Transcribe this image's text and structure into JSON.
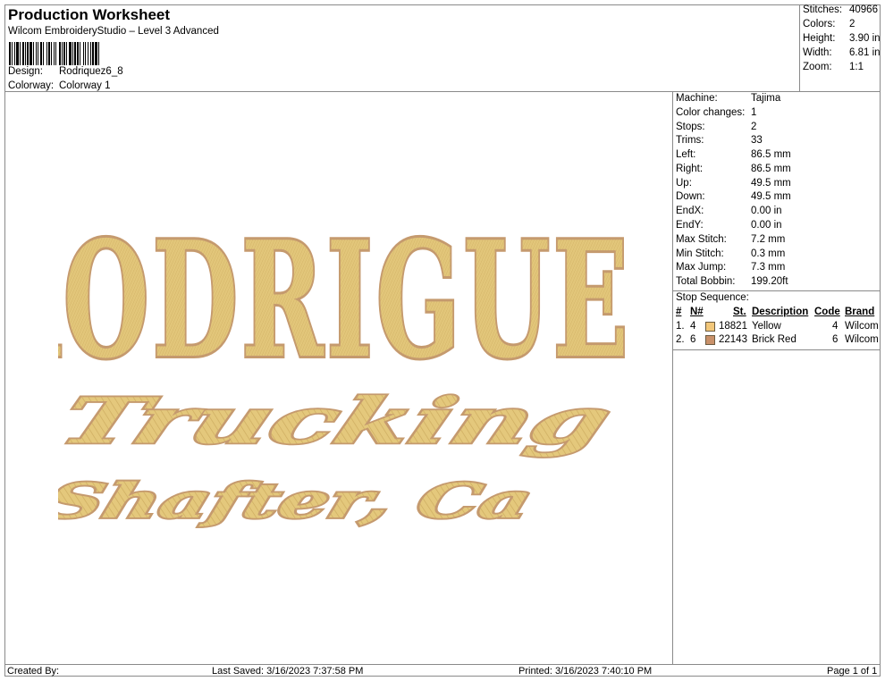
{
  "header": {
    "title": "Production Worksheet",
    "app": "Wilcom EmbroideryStudio – Level 3 Advanced",
    "design_label": "Design:",
    "design_value": "Rodriquez6_8",
    "colorway_label": "Colorway:",
    "colorway_value": "Colorway 1"
  },
  "stats": [
    {
      "k": "Stitches:",
      "v": "40966"
    },
    {
      "k": "Colors:",
      "v": "2"
    },
    {
      "k": "Height:",
      "v": "3.90 in"
    },
    {
      "k": "Width:",
      "v": "6.81 in"
    },
    {
      "k": "Zoom:",
      "v": "1:1"
    }
  ],
  "design": {
    "line1": "RODRIGUEZ",
    "line2": "Trucking",
    "line3": "Shafter, Ca",
    "fill_color": "#e2c67a",
    "outline_color": "#c59a6e"
  },
  "machine_info": [
    {
      "k": "Machine:",
      "v": "Tajima"
    },
    {
      "k": "Color changes:",
      "v": "1"
    },
    {
      "k": "Stops:",
      "v": "2"
    },
    {
      "k": "Trims:",
      "v": "33"
    },
    {
      "k": "Left:",
      "v": "86.5 mm"
    },
    {
      "k": "Right:",
      "v": "86.5 mm"
    },
    {
      "k": "Up:",
      "v": "49.5 mm"
    },
    {
      "k": "Down:",
      "v": "49.5 mm"
    },
    {
      "k": "EndX:",
      "v": "0.00 in"
    },
    {
      "k": "EndY:",
      "v": "0.00 in"
    },
    {
      "k": "Max Stitch:",
      "v": "7.2 mm"
    },
    {
      "k": "Min Stitch:",
      "v": "0.3 mm"
    },
    {
      "k": "Max Jump:",
      "v": "7.3 mm"
    },
    {
      "k": "Total Bobbin:",
      "v": "199.20ft"
    }
  ],
  "stop_sequence": {
    "heading": "Stop Sequence:",
    "columns": {
      "num": "#",
      "n": "N#",
      "st": "St.",
      "desc": "Description",
      "code": "Code",
      "brand": "Brand"
    },
    "rows": [
      {
        "num": "1.",
        "n": "4",
        "color": "#f2c77a",
        "st": "18821",
        "desc": "Yellow",
        "code": "4",
        "brand": "Wilcom"
      },
      {
        "num": "2.",
        "n": "6",
        "color": "#c9916a",
        "st": "22143",
        "desc": "Brick Red",
        "code": "6",
        "brand": "Wilcom"
      }
    ]
  },
  "footer": {
    "created": "Created By:",
    "saved": "Last Saved: 3/16/2023 7:37:58 PM",
    "printed": "Printed: 3/16/2023 7:40:10 PM",
    "page": "Page 1 of 1"
  }
}
